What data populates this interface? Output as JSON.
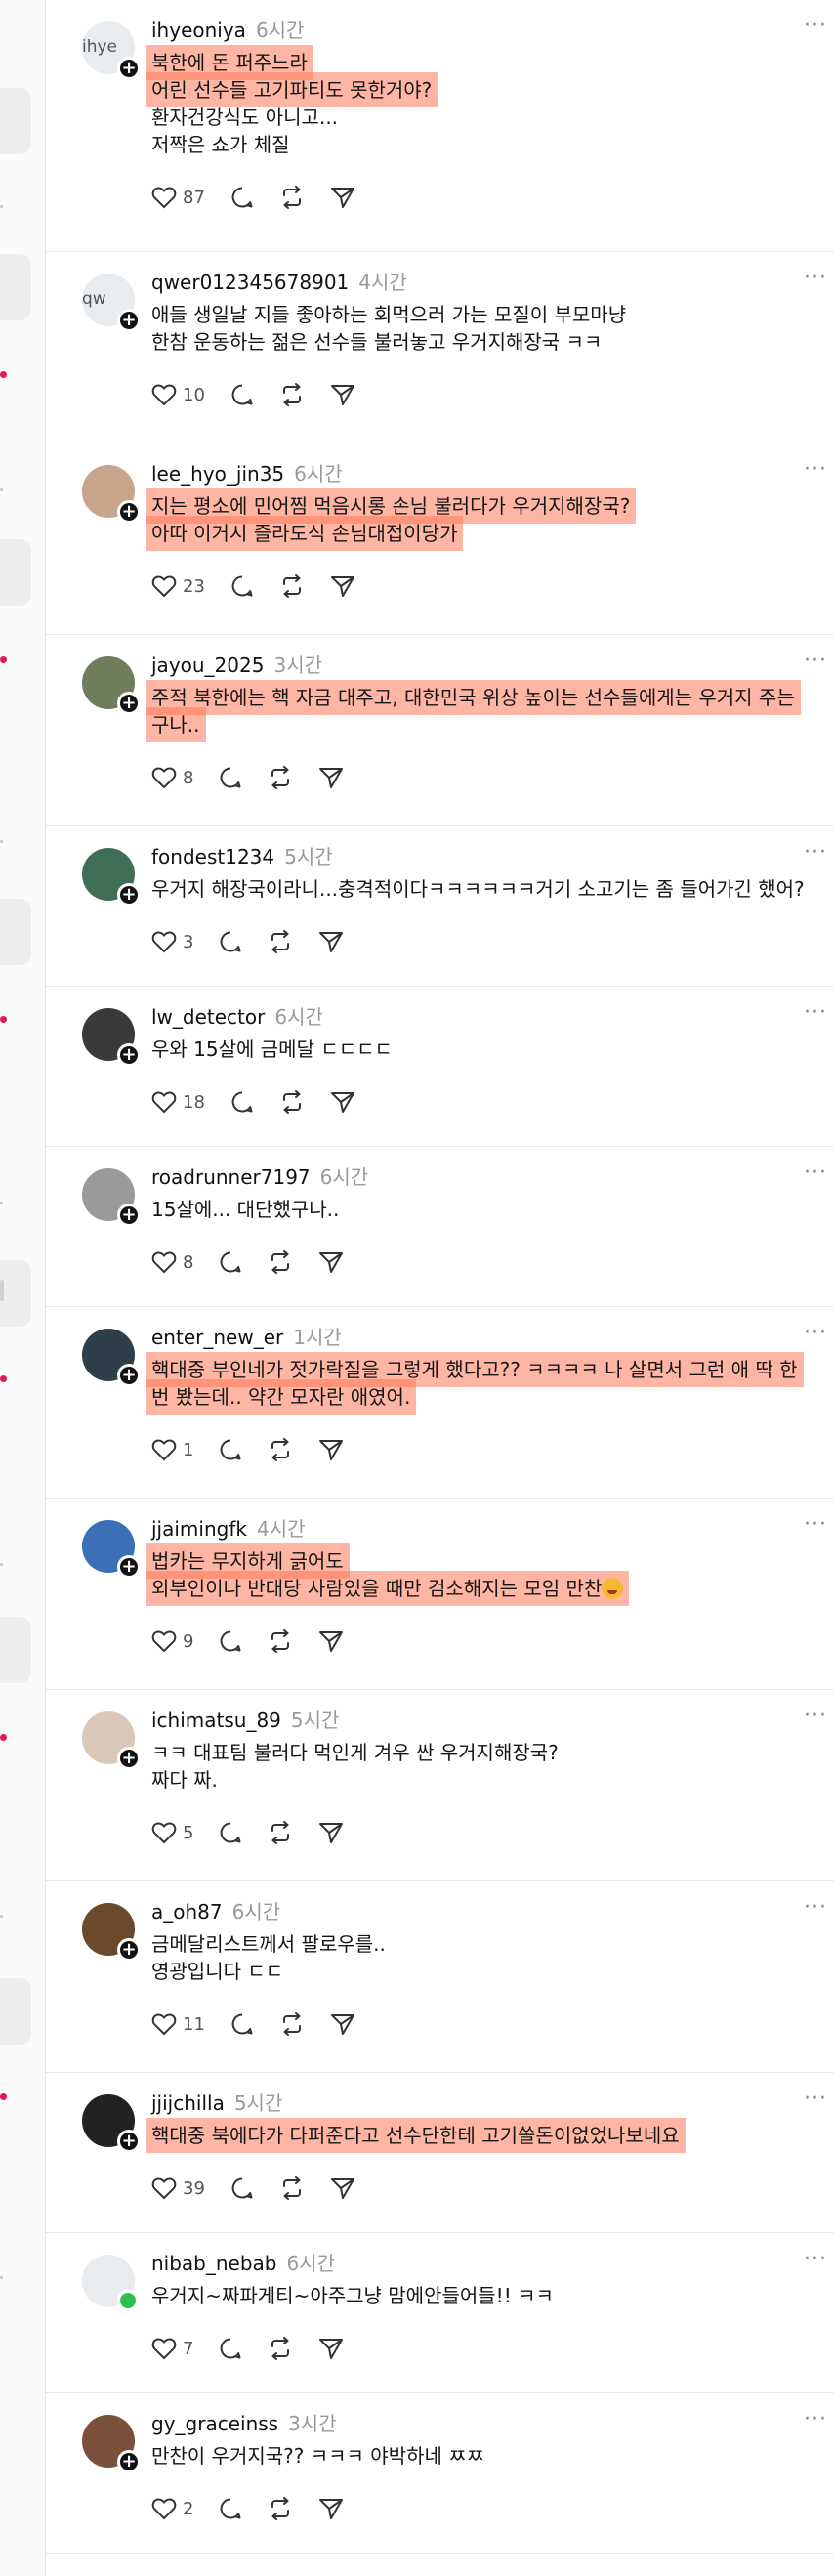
{
  "colors": {
    "highlight": "#ff785a",
    "avatar_plus": "#111111",
    "online": "#2ec04f",
    "rail_dot": "#e5194f"
  },
  "icons": {
    "like": "heart-icon",
    "reply": "comment-icon",
    "repost": "repost-icon",
    "share": "send-icon",
    "more": "more-icon"
  },
  "posts": [
    {
      "username": "ihyeoniya",
      "time": "6시간",
      "lines": [
        "북한에 돈 퍼주느라",
        "어린 선수들 고기파티도 못한거야?",
        "환자건강식도 아니고...",
        "저짝은 쇼가 체질"
      ],
      "likes": "87",
      "avatar_text": "ihye"
    },
    {
      "username": "qwer012345678901",
      "time": "4시간",
      "lines": [
        "애들 생일날 지들 좋아하는 회먹으러 가는 모질이 부모마냥",
        "한참 운동하는 젊은 선수들 불러놓고 우거지해장국 ㅋㅋ"
      ],
      "likes": "10",
      "avatar_text": "qw"
    },
    {
      "username": "lee_hyo_jin35",
      "time": "6시간",
      "lines": [
        "지는 평소에 민어찜 먹음시롱 손님 불러다가 우거지해장국?",
        "아따 이거시 즐라도식 손님대접이당가"
      ],
      "likes": "23",
      "avatar_text": ""
    },
    {
      "username": "jayou_2025",
      "time": "3시간",
      "lines": [
        "주적 북한에는 핵 자금 대주고, 대한민국 위상 높이는 선수들에게는 우거지 주는",
        "구나.."
      ],
      "likes": "8",
      "avatar_text": ""
    },
    {
      "username": "fondest1234",
      "time": "5시간",
      "lines": [
        "우거지 해장국이라니...충격적이다ㅋㅋㅋㅋㅋㅋ거기 소고기는 좀 들어가긴 했어?"
      ],
      "likes": "3",
      "avatar_text": ""
    },
    {
      "username": "lw_detector",
      "time": "6시간",
      "lines": [
        "우와 15살에 금메달 ㄷㄷㄷㄷ"
      ],
      "likes": "18",
      "avatar_text": ""
    },
    {
      "username": "roadrunner7197",
      "time": "6시간",
      "lines": [
        "15살에... 대단했구나.."
      ],
      "likes": "8",
      "avatar_text": ""
    },
    {
      "username": "enter_new_er",
      "time": "1시간",
      "lines": [
        "핵대중 부인네가 젓가락질을 그렇게 했다고?? ㅋㅋㅋㅋ 나 살면서 그런 애 딱 한",
        "번 봤는데.. 약간 모자란 애였어."
      ],
      "likes": "1",
      "avatar_text": ""
    },
    {
      "username": "jjaimingfk",
      "time": "4시간",
      "lines": [
        "법카는 무지하게 긁어도",
        "외부인이나 반대당 사람있을 때만 검소해지는 모임 만찬"
      ],
      "likes": "9",
      "avatar_text": ""
    },
    {
      "username": "ichimatsu_89",
      "time": "5시간",
      "lines": [
        "ㅋㅋ 대표팀 불러다 먹인게 겨우 싼 우거지해장국?",
        "짜다 짜."
      ],
      "likes": "5",
      "avatar_text": ""
    },
    {
      "username": "a_oh87",
      "time": "6시간",
      "lines": [
        "금메달리스트께서 팔로우를..",
        "영광입니다 ㄷㄷ"
      ],
      "likes": "11",
      "avatar_text": ""
    },
    {
      "username": "jjijchilla",
      "time": "5시간",
      "lines": [
        "핵대중 북에다가 다퍼준다고 선수단한테 고기쏠돈이없었나보네요"
      ],
      "likes": "39",
      "avatar_text": ""
    },
    {
      "username": "nibab_nebab",
      "time": "6시간",
      "lines": [
        "우거지~짜파게티~아주그냥 맘에안들어들!! ㅋㅋ"
      ],
      "likes": "7",
      "avatar_text": ""
    },
    {
      "username": "gy_graceinss",
      "time": "3시간",
      "lines": [
        "만찬이 우거지국?? ㅋㅋㅋ 야박하네 ㅉㅉ"
      ],
      "likes": "2",
      "avatar_text": ""
    }
  ]
}
